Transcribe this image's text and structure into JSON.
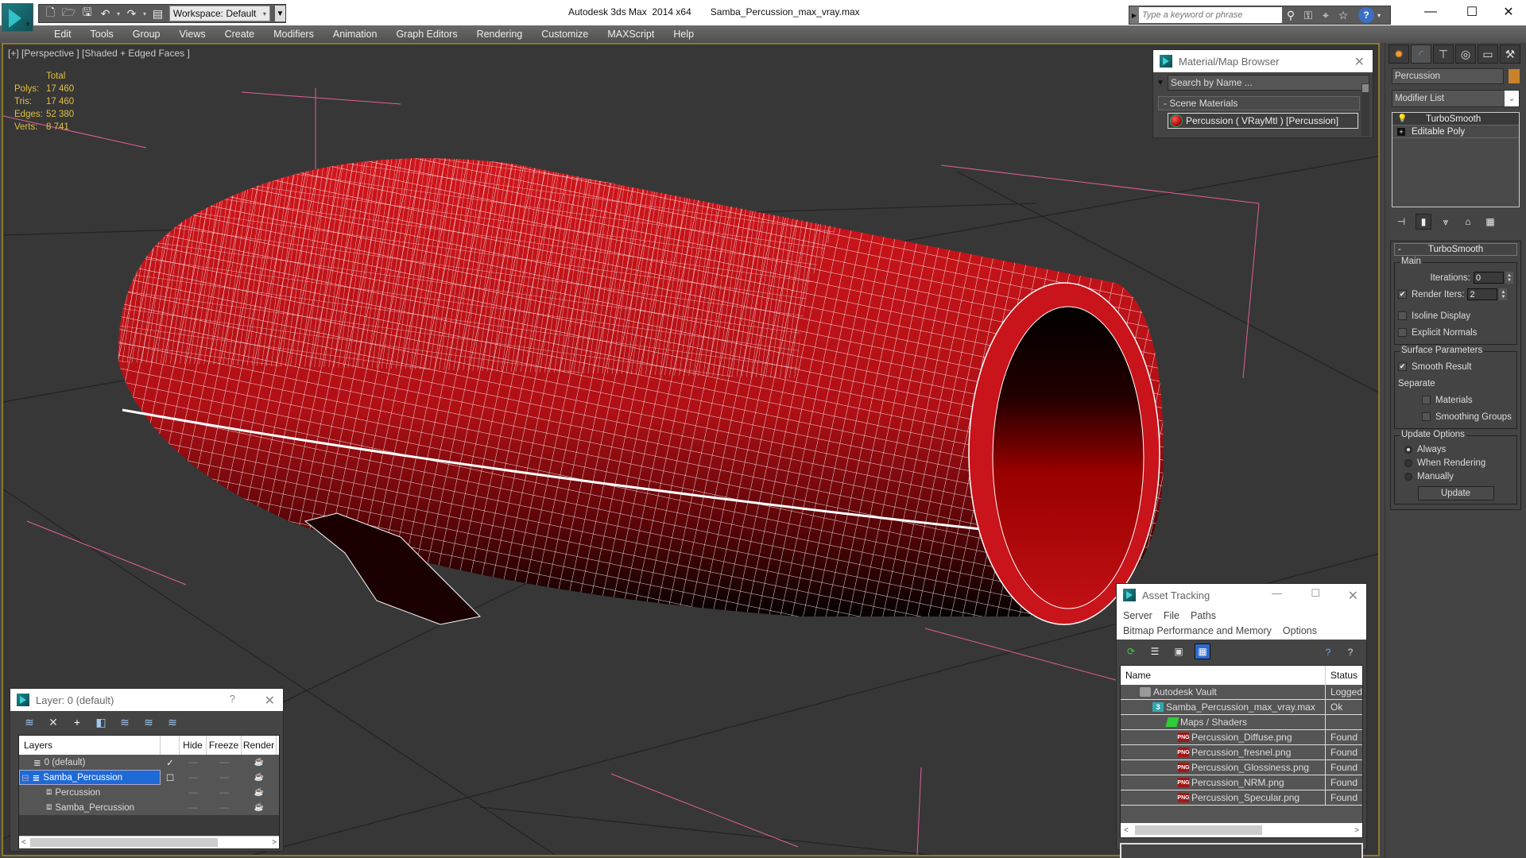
{
  "titlebar": {
    "app_title": "Autodesk 3ds Max  2014 x64",
    "file_title": "Samba_Percussion_max_vray.max",
    "workspace_label": "Workspace: Default",
    "search_placeholder": "Type a keyword or phrase",
    "icons": [
      "new-file-icon",
      "open-file-icon",
      "save-icon",
      "undo-icon",
      "redo-icon",
      "project-folder-icon"
    ],
    "search_tools": [
      "binoculars-icon",
      "key-icon",
      "satellite-dish-icon",
      "star-icon",
      "help-icon"
    ],
    "window_controls": [
      "minimize",
      "maximize",
      "close"
    ]
  },
  "menu": {
    "items": [
      "Edit",
      "Tools",
      "Group",
      "Views",
      "Create",
      "Modifiers",
      "Animation",
      "Graph Editors",
      "Rendering",
      "Customize",
      "MAXScript",
      "Help"
    ]
  },
  "viewport": {
    "label": "[+] [Perspective ] [Shaded + Edged Faces ]",
    "stats": {
      "header": "Total",
      "rows": [
        {
          "label": "Polys:",
          "value": "17 460"
        },
        {
          "label": "Tris:",
          "value": "17 460"
        },
        {
          "label": "Edges:",
          "value": "52 380"
        },
        {
          "label": "Verts:",
          "value": "8 741"
        }
      ]
    },
    "object_color": "#c0141a"
  },
  "material_browser": {
    "title": "Material/Map Browser",
    "search_placeholder": "Search by Name ...",
    "section": "- Scene Materials",
    "item": "Percussion  ( VRayMtl )  [Percussion]"
  },
  "command_panel": {
    "tabs": [
      "create-tab",
      "modify-tab",
      "hierarchy-tab",
      "motion-tab",
      "display-tab",
      "utilities-tab"
    ],
    "object_name": "Percussion",
    "object_color": "#c8822e",
    "modifier_list_label": "Modifier List",
    "stack": [
      "TurboSmooth",
      "Editable Poly"
    ],
    "turbosmooth": {
      "title": "TurboSmooth",
      "main_label": "Main",
      "iterations_label": "Iterations:",
      "iterations_value": "0",
      "render_iters_label": "Render Iters:",
      "render_iters_value": "2",
      "render_iters_checked": true,
      "isoline_label": "Isoline Display",
      "explicit_normals_label": "Explicit Normals",
      "surface_label": "Surface Parameters",
      "smooth_result_label": "Smooth Result",
      "separate_label": "Separate",
      "materials_label": "Materials",
      "smoothing_groups_label": "Smoothing Groups",
      "update_options_label": "Update Options",
      "always_label": "Always",
      "when_rendering_label": "When Rendering",
      "manually_label": "Manually",
      "update_button": "Update"
    }
  },
  "layer_window": {
    "title": "Layer: 0 (default)",
    "help": "?",
    "columns": [
      "Layers",
      "",
      "Hide",
      "Freeze",
      "Render"
    ],
    "rows": [
      {
        "name": "0 (default)",
        "current": "✓",
        "indent": 0
      },
      {
        "name": "Samba_Percussion",
        "current": "☐",
        "indent": 0,
        "selected": true
      },
      {
        "name": "Percussion",
        "current": "",
        "indent": 1
      },
      {
        "name": "Samba_Percussion",
        "current": "",
        "indent": 1
      }
    ]
  },
  "asset_tracking": {
    "title": "Asset Tracking",
    "menu_row1": [
      "Server",
      "File",
      "Paths"
    ],
    "menu_row2": [
      "Bitmap Performance and Memory",
      "Options"
    ],
    "columns": [
      "Name",
      "Status"
    ],
    "rows": [
      {
        "name": "Autodesk Vault",
        "status": "Logged",
        "icon": "vault",
        "indent": 1
      },
      {
        "name": "Samba_Percussion_max_vray.max",
        "status": "Ok",
        "icon": "max",
        "indent": 2
      },
      {
        "name": "Maps / Shaders",
        "status": "",
        "icon": "maps",
        "indent": 3
      },
      {
        "name": "Percussion_Diffuse.png",
        "status": "Found",
        "icon": "png",
        "indent": 4
      },
      {
        "name": "Percussion_fresnel.png",
        "status": "Found",
        "icon": "png",
        "indent": 4
      },
      {
        "name": "Percussion_Glossiness.png",
        "status": "Found",
        "icon": "png",
        "indent": 4
      },
      {
        "name": "Percussion_NRM.png",
        "status": "Found",
        "icon": "png",
        "indent": 4
      },
      {
        "name": "Percussion_Specular.png",
        "status": "Found",
        "icon": "png",
        "indent": 4
      }
    ]
  }
}
